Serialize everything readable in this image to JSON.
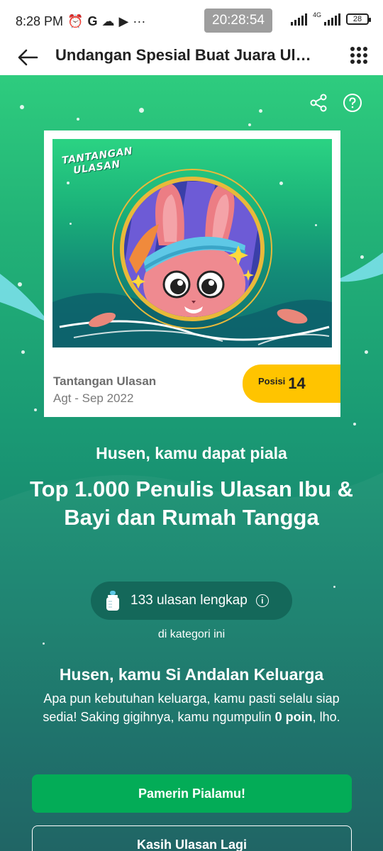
{
  "status_bar": {
    "time": "8:28 PM",
    "icons": [
      "alarm-icon",
      "google-icon",
      "cloud-icon",
      "youtube-icon",
      "more-dots-icon"
    ],
    "clock_overlay": "20:28:54",
    "network": "4G",
    "battery": "28"
  },
  "app_bar": {
    "title": "Undangan Spesial Buat Juara Ulasan",
    "back_icon": "arrow-left-icon",
    "menu_icon": "grid-menu-icon"
  },
  "actions": {
    "share_icon": "share-icon",
    "help_icon": "help-icon"
  },
  "card": {
    "art_logo_line1": "TANTANGAN",
    "art_logo_line2": "ULASAN",
    "title": "Tantangan Ulasan",
    "period": "Agt - Sep 2022",
    "rank_label": "Posisi",
    "rank_value": "14",
    "colors": {
      "badge": "#ffc400",
      "ring": "#e8b93a"
    }
  },
  "trophy": {
    "subhead": "Husen, kamu dapat piala",
    "headline": "Top 1.000 Penulis Ulasan Ibu & Bayi dan Rumah Tangga"
  },
  "stat": {
    "icon": "baby-bottle-icon",
    "text": "133 ulasan lengkap",
    "caption": "di kategori ini"
  },
  "persona": {
    "title": "Husen, kamu Si Andalan Keluarga",
    "desc_part1": "Apa pun kebutuhan keluarga, kamu pasti selalu siap sedia! Saking gigihnya, kamu ngumpulin ",
    "desc_bold": "0 poin",
    "desc_part2": ", lho."
  },
  "buttons": {
    "primary": "Pamerin Pialamu!",
    "secondary": "Kasih Ulasan Lagi"
  },
  "theme": {
    "accent": "#03ac57",
    "bg_top": "#2ecc7e",
    "bg_bottom": "#175f5f"
  }
}
